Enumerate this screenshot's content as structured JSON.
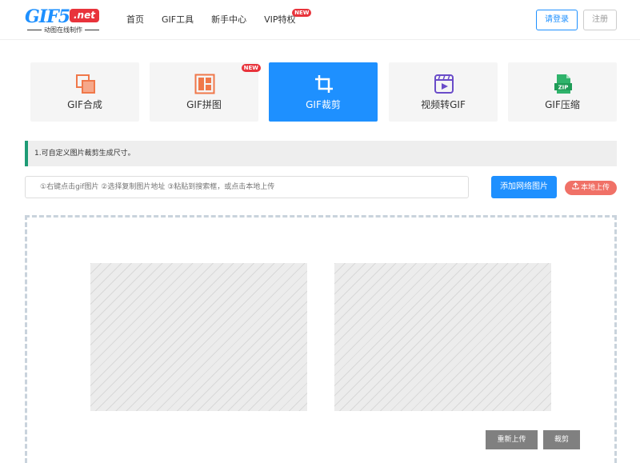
{
  "brand": {
    "name": "GIF5",
    "tld": ".net",
    "tagline": "动图在线制作"
  },
  "nav": {
    "items": [
      {
        "label": "首页"
      },
      {
        "label": "GIF工具"
      },
      {
        "label": "新手中心"
      },
      {
        "label": "VIP特权",
        "badge": "NEW"
      }
    ]
  },
  "auth": {
    "login": "请登录",
    "register": "注册"
  },
  "tools": [
    {
      "label": "GIF合成",
      "icon": "gif-compose-icon"
    },
    {
      "label": "GIF拼图",
      "icon": "gif-collage-icon",
      "badge": "NEW"
    },
    {
      "label": "GIF裁剪",
      "icon": "crop-icon",
      "active": true
    },
    {
      "label": "视频转GIF",
      "icon": "video-icon"
    },
    {
      "label": "GIF压缩",
      "icon": "zip-icon"
    }
  ],
  "notice": "1.可自定义图片裁剪生成尺寸。",
  "upload": {
    "placeholder": "①右键点击gif图片 ②选择复制图片地址 ③粘贴到搜索框，或点击本地上传",
    "add_button": "添加网络图片",
    "local_button": "本地上传"
  },
  "actions": {
    "reupload": "重新上传",
    "crop": "裁剪"
  },
  "colors": {
    "accent": "#1e90ff",
    "danger": "#e8333b",
    "local": "#f07167",
    "notice_bar": "#1e9b75"
  }
}
